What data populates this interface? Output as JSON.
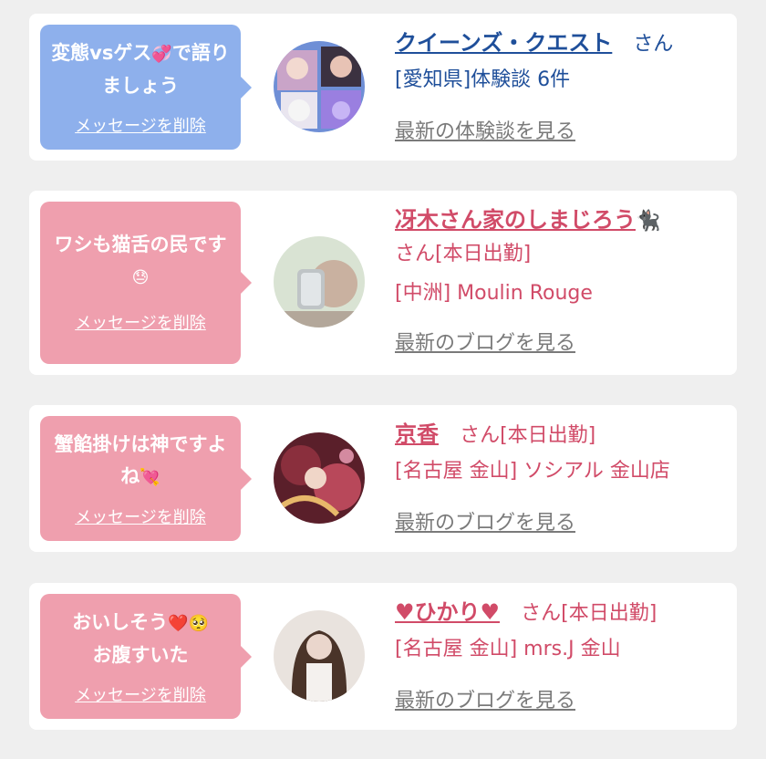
{
  "items": [
    {
      "message": "変態vsゲス",
      "message_emoji": "💞",
      "message_tail": "で語りましょう",
      "delete_label": "メッセージを削除",
      "name": "クイーンズ・クエスト",
      "suffix": "さん",
      "detail": "[愛知県]体験談 6件",
      "link_label": "最新の体験談を見る",
      "bubble_color": "#8eb0ec"
    },
    {
      "message": "ワシも猫舌の民です",
      "message_emoji": "😓",
      "delete_label": "メッセージを削除",
      "name": "冴木さん家のしまじろう",
      "name_emoji": "🐈‍⬛",
      "suffix": "さん[本日出勤]",
      "detail": "[中洲] Moulin Rouge",
      "link_label": "最新のブログを見る",
      "bubble_color": "#ef9fae"
    },
    {
      "message": "蟹餡掛けは神ですよね",
      "message_emoji": "💘",
      "delete_label": "メッセージを削除",
      "name": "京香",
      "suffix": "さん[本日出勤]",
      "detail": "[名古屋 金山] ソシアル 金山店",
      "link_label": "最新のブログを見る",
      "bubble_color": "#ef9fae"
    },
    {
      "message": "おいしそう",
      "message_emoji": "❤️🥺",
      "message_tail": "お腹すいた",
      "delete_label": "メッセージを削除",
      "name": "♥ひかり♥",
      "suffix": "さん[本日出勤]",
      "detail": "[名古屋 金山] mrs.J 金山",
      "link_label": "最新のブログを見る",
      "bubble_color": "#ef9fae"
    }
  ]
}
